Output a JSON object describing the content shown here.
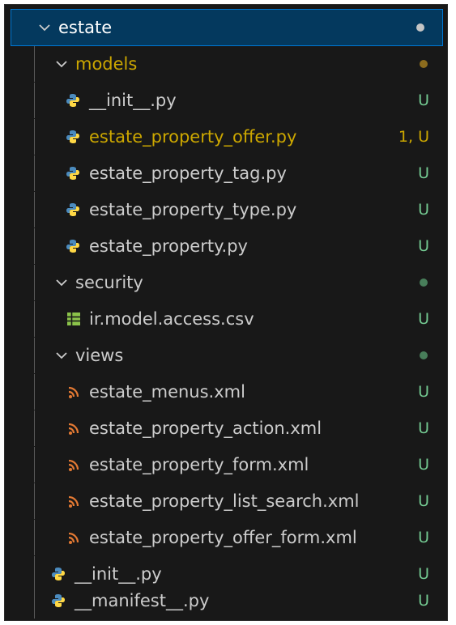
{
  "tree": {
    "root": {
      "label": "estate",
      "dot_color": "#cccccc"
    },
    "models": {
      "label": "models",
      "dot_color": "#8c6c1e"
    },
    "model_files": [
      {
        "name": "__init__.py",
        "status": "U"
      },
      {
        "name": "estate_property_offer.py",
        "status": "1, U"
      },
      {
        "name": "estate_property_tag.py",
        "status": "U"
      },
      {
        "name": "estate_property_type.py",
        "status": "U"
      },
      {
        "name": "estate_property.py",
        "status": "U"
      }
    ],
    "security": {
      "label": "security",
      "dot_color": "#487e5a"
    },
    "security_files": [
      {
        "name": "ir.model.access.csv",
        "status": "U"
      }
    ],
    "views": {
      "label": "views",
      "dot_color": "#487e5a"
    },
    "view_files": [
      {
        "name": "estate_menus.xml",
        "status": "U"
      },
      {
        "name": "estate_property_action.xml",
        "status": "U"
      },
      {
        "name": "estate_property_form.xml",
        "status": "U"
      },
      {
        "name": "estate_property_list_search.xml",
        "status": "U"
      },
      {
        "name": "estate_property_offer_form.xml",
        "status": "U"
      }
    ],
    "root_files": [
      {
        "name": "__init__.py",
        "status": "U"
      },
      {
        "name": "__manifest__.py",
        "status": "U"
      }
    ]
  },
  "colors": {
    "untracked": "#73c991",
    "warning": "#cca700",
    "python_blue": "#4b8bbe",
    "python_yellow": "#ffd845",
    "xml_orange": "#e37933",
    "csv_green": "#8bc34a"
  },
  "icons": {
    "folder_open": "chevron-down-icon",
    "python": "python-icon",
    "xml": "rss-xml-icon",
    "csv": "table-icon"
  }
}
